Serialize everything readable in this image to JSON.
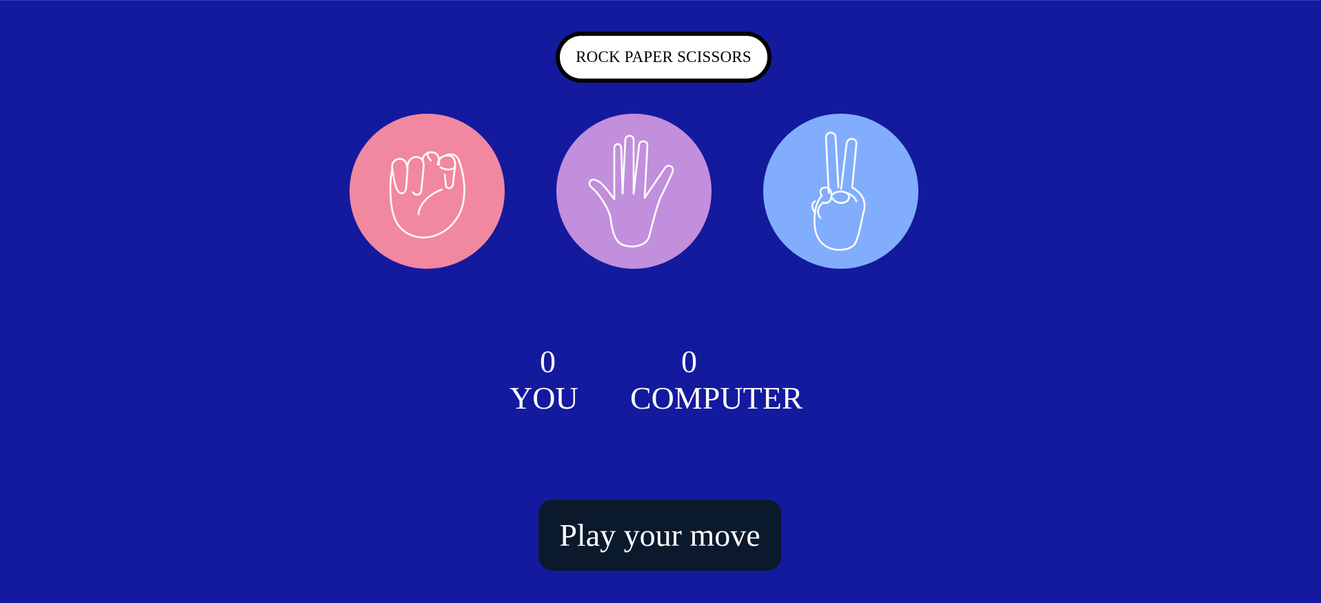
{
  "header": {
    "title": "ROCK PAPER SCISSORS"
  },
  "choices": [
    {
      "id": "rock",
      "color": "#f287a0",
      "icon": "fist-icon"
    },
    {
      "id": "paper",
      "color": "#c18fdc",
      "icon": "open-hand-icon"
    },
    {
      "id": "scissors",
      "color": "#82adfd",
      "icon": "peace-hand-icon"
    }
  ],
  "scoreboard": {
    "user": {
      "score": "0",
      "label": "YOU"
    },
    "computer": {
      "score": "0",
      "label": "COMPUTER"
    }
  },
  "message": {
    "text": "Play your move"
  },
  "colors": {
    "background": "#141a9e",
    "message_bg": "#0b192c"
  }
}
